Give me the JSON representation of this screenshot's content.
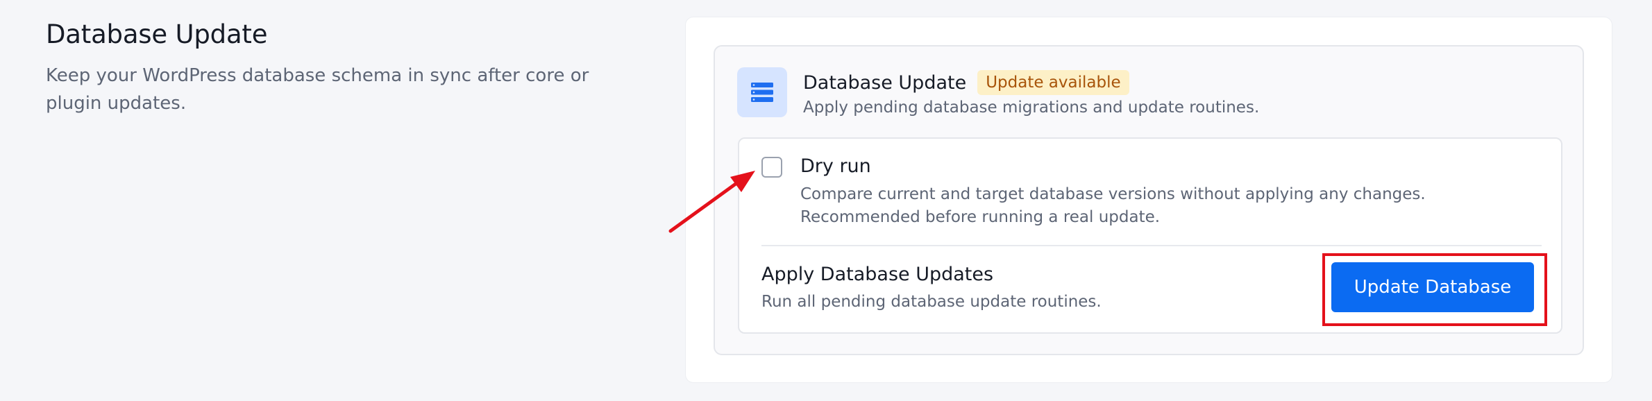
{
  "section": {
    "title": "Database Update",
    "description": "Keep your WordPress database schema in sync after core or plugin updates."
  },
  "panel": {
    "icon": "database-icon",
    "title": "Database Update",
    "badge": "Update available",
    "subtitle": "Apply pending database migrations and update routines."
  },
  "dry_run": {
    "label": "Dry run",
    "checked": false,
    "description": "Compare current and target database versions without applying any changes. Recommended before running a real update."
  },
  "apply": {
    "title": "Apply Database Updates",
    "description": "Run all pending database update routines.",
    "button_label": "Update Database"
  },
  "colors": {
    "accent": "#0b6bf2",
    "badge_bg": "#fdf0c7",
    "badge_text": "#a8540a",
    "annotation": "#e4111b"
  }
}
